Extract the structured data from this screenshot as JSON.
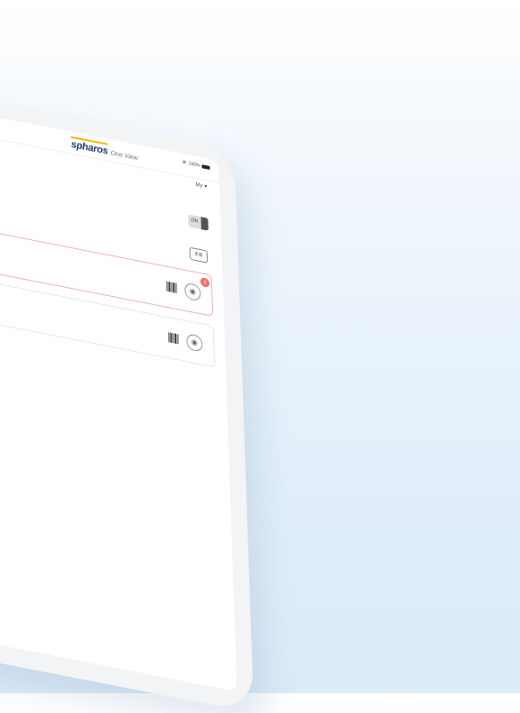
{
  "status_bar": {
    "battery": "100%"
  },
  "header": {
    "brand_name": "spharos",
    "app_name": "One View",
    "user_menu": "My ▾"
  },
  "toolbar": {
    "toggle_label": "ON",
    "button_label": "조회"
  },
  "list": {
    "items": [
      {
        "state": "alert",
        "notification_count": "2",
        "icons": [
          "barcode-icon",
          "camera-icon"
        ]
      },
      {
        "state": "normal",
        "icons": [
          "barcode-icon",
          "camera-icon"
        ]
      }
    ]
  },
  "colors": {
    "brand_accent": "#f2b705",
    "brand_text": "#1f3c73",
    "alert_border": "#f2b3b3",
    "alert_badge": "#f27272"
  }
}
